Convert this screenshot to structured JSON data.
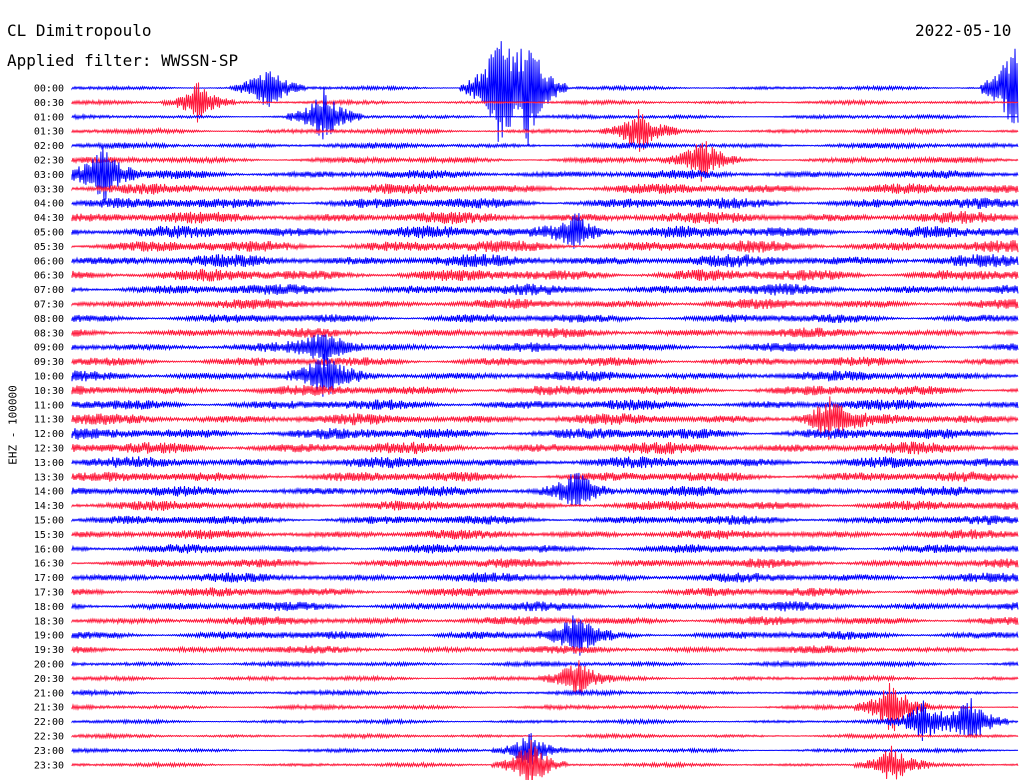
{
  "header": {
    "station": "CL Dimitropoulo",
    "filter": "Applied filter: WWSSN-SP",
    "date": "2022-05-10"
  },
  "chart_data": {
    "type": "helicorder",
    "channel_label": "EHZ - 100000",
    "row_labels": [
      "00:00",
      "00:30",
      "01:00",
      "01:30",
      "02:00",
      "02:30",
      "03:00",
      "03:30",
      "04:00",
      "04:30",
      "05:00",
      "05:30",
      "06:00",
      "06:30",
      "07:00",
      "07:30",
      "08:00",
      "08:30",
      "09:00",
      "09:30",
      "10:00",
      "10:30",
      "11:00",
      "11:30",
      "12:00",
      "12:30",
      "13:00",
      "13:30",
      "14:00",
      "14:30",
      "15:00",
      "15:30",
      "16:00",
      "16:30",
      "17:00",
      "17:30",
      "18:00",
      "18:30",
      "19:00",
      "19:30",
      "20:00",
      "20:30",
      "21:00",
      "21:30",
      "22:00",
      "22:30",
      "23:00",
      "23:30"
    ],
    "row_minutes": 30,
    "row_colors": [
      "#0000ff",
      "#ff1a3c"
    ],
    "noise_level_per_row": [
      0.3,
      0.3,
      0.3,
      0.4,
      0.45,
      0.5,
      0.7,
      0.85,
      0.9,
      0.95,
      1.0,
      1.0,
      1.0,
      1.0,
      0.9,
      0.8,
      0.75,
      0.75,
      0.75,
      0.75,
      0.8,
      0.85,
      0.85,
      0.9,
      0.95,
      0.95,
      0.9,
      0.85,
      0.8,
      0.8,
      0.75,
      0.75,
      0.75,
      0.75,
      0.75,
      0.75,
      0.75,
      0.7,
      0.7,
      0.6,
      0.4,
      0.35,
      0.35,
      0.35,
      0.3,
      0.3,
      0.3,
      0.3
    ],
    "bursts": [
      {
        "row": 0,
        "minute": 6.2,
        "amp": 3.5
      },
      {
        "row": 0,
        "minute": 13.5,
        "amp": 8
      },
      {
        "row": 0,
        "minute": 14.5,
        "amp": 8
      },
      {
        "row": 0,
        "minute": 30,
        "amp": 9
      },
      {
        "row": 0,
        "minute": 31,
        "amp": 9
      },
      {
        "row": 0,
        "minute": 32,
        "amp": 9
      },
      {
        "row": 0,
        "minute": 53,
        "amp": 6
      },
      {
        "row": 1,
        "minute": 4,
        "amp": 3
      },
      {
        "row": 2,
        "minute": 8,
        "amp": 4
      },
      {
        "row": 3,
        "minute": 18,
        "amp": 3
      },
      {
        "row": 5,
        "minute": 20,
        "amp": 3
      },
      {
        "row": 6,
        "minute": 1,
        "amp": 4
      },
      {
        "row": 10,
        "minute": 16,
        "amp": 3
      },
      {
        "row": 18,
        "minute": 8,
        "amp": 3
      },
      {
        "row": 20,
        "minute": 8,
        "amp": 3
      },
      {
        "row": 23,
        "minute": 24,
        "amp": 3
      },
      {
        "row": 28,
        "minute": 16,
        "amp": 3
      },
      {
        "row": 38,
        "minute": 16,
        "amp": 3
      },
      {
        "row": 41,
        "minute": 16,
        "amp": 3
      },
      {
        "row": 43,
        "minute": 26,
        "amp": 4
      },
      {
        "row": 44,
        "minute": 28.5,
        "amp": 4
      },
      {
        "row": 44,
        "minute": 27,
        "amp": 3
      },
      {
        "row": 46,
        "minute": 14.5,
        "amp": 3
      },
      {
        "row": 47,
        "minute": 14.5,
        "amp": 4
      },
      {
        "row": 47,
        "minute": 26,
        "amp": 3
      }
    ]
  }
}
